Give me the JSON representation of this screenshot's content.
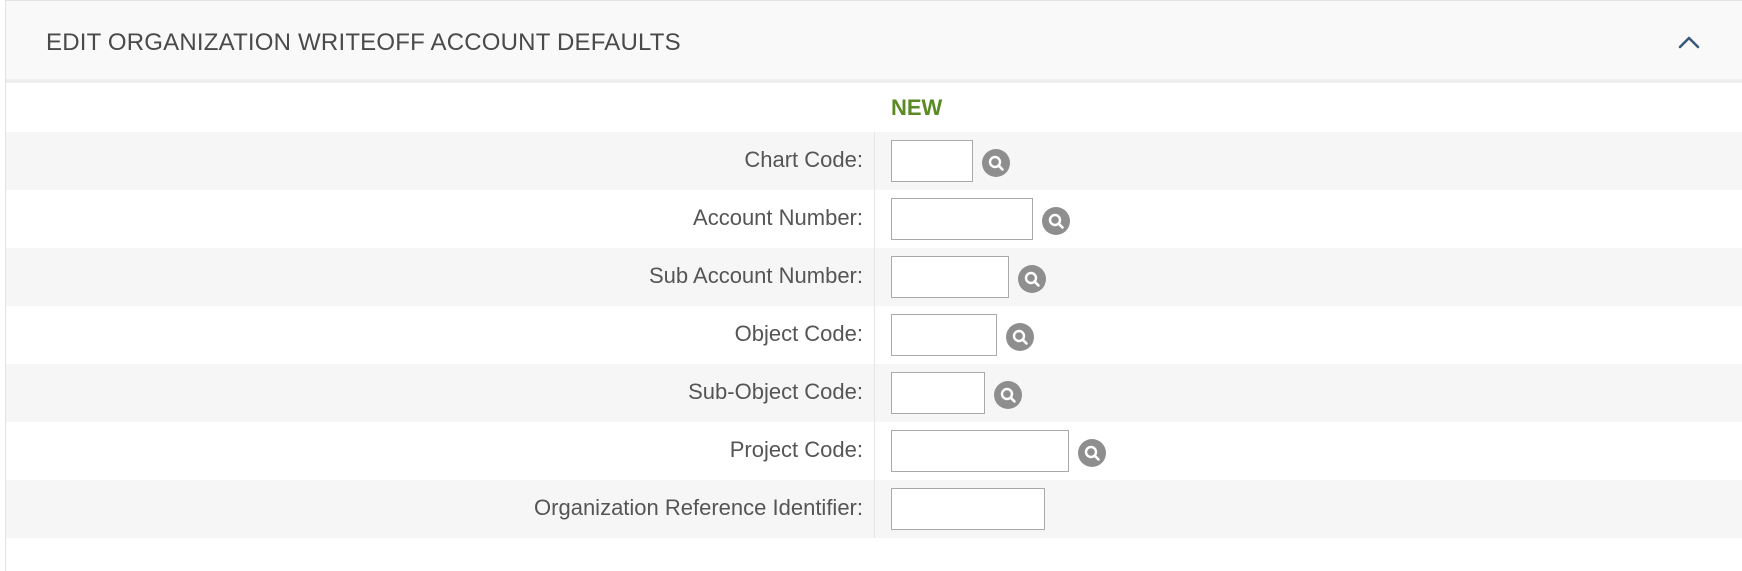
{
  "panel": {
    "title": "EDIT ORGANIZATION WRITEOFF ACCOUNT DEFAULTS",
    "collapse_icon": "chevron-up-icon"
  },
  "column_header": "NEW",
  "fields": [
    {
      "label": "Chart Code:",
      "value": "",
      "lookup": true
    },
    {
      "label": "Account Number:",
      "value": "",
      "lookup": true
    },
    {
      "label": "Sub Account Number:",
      "value": "",
      "lookup": true
    },
    {
      "label": "Object Code:",
      "value": "",
      "lookup": true
    },
    {
      "label": "Sub-Object Code:",
      "value": "",
      "lookup": true
    },
    {
      "label": "Project Code:",
      "value": "",
      "lookup": true
    },
    {
      "label": "Organization Reference Identifier:",
      "value": "",
      "lookup": false
    }
  ],
  "colors": {
    "new_label": "#5a8a23",
    "lookup_button": "#8e8e8e",
    "row_alt": "#f6f6f6"
  }
}
